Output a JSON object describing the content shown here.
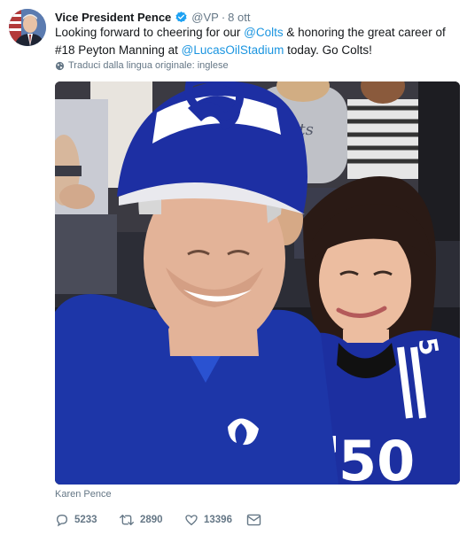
{
  "tweet": {
    "author_name": "Vice President Pence",
    "handle": "@VP",
    "separator": "·",
    "time": "8 ott",
    "text_parts": {
      "t1": "Looking forward to cheering for our ",
      "m1": "@Colts",
      "t2": " & honoring the great career of #18 Peyton Manning at ",
      "m2": "@LucasOilStadium",
      "t3": " today. Go Colts!"
    },
    "translate_label": "Traduci dalla lingua originale: inglese",
    "photo_caption": "Karen Pence"
  },
  "actions": {
    "replies": "5233",
    "retweets": "2890",
    "likes": "13396"
  },
  "photo_print": {
    "jersey_number": "50",
    "logo_text": "Colts"
  },
  "colors": {
    "link": "#1b95e0",
    "muted": "#657786",
    "verified": "#1da1f2",
    "colts_blue": "#1c3aa9"
  }
}
